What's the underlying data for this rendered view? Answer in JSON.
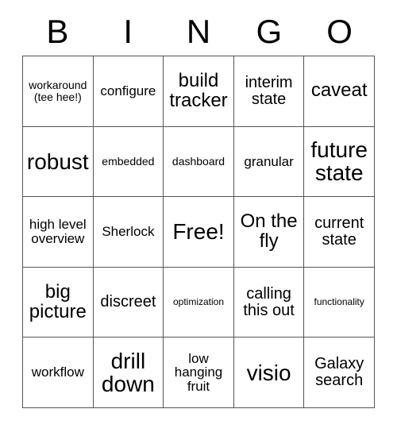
{
  "card": {
    "header_letters": [
      "B",
      "I",
      "N",
      "G",
      "O"
    ],
    "rows": [
      [
        {
          "text": "workaround (tee hee!)",
          "size": "fs-s"
        },
        {
          "text": "configure",
          "size": "fs-m"
        },
        {
          "text": "build tracker",
          "size": "fs-xl"
        },
        {
          "text": "interim state",
          "size": "fs-l"
        },
        {
          "text": "caveat",
          "size": "fs-xl"
        }
      ],
      [
        {
          "text": "robust",
          "size": "fs-xxl"
        },
        {
          "text": "embedded",
          "size": "fs-s"
        },
        {
          "text": "dashboard",
          "size": "fs-s"
        },
        {
          "text": "granular",
          "size": "fs-m"
        },
        {
          "text": "future state",
          "size": "fs-xxl"
        }
      ],
      [
        {
          "text": "high level overview",
          "size": "fs-m"
        },
        {
          "text": "Sherlock",
          "size": "fs-m"
        },
        {
          "text": "Free!",
          "size": "fs-xxl"
        },
        {
          "text": "On the fly",
          "size": "fs-xl"
        },
        {
          "text": "current state",
          "size": "fs-l"
        }
      ],
      [
        {
          "text": "big picture",
          "size": "fs-xl"
        },
        {
          "text": "discreet",
          "size": "fs-l"
        },
        {
          "text": "optimization",
          "size": "fs-xs"
        },
        {
          "text": "calling this out",
          "size": "fs-l"
        },
        {
          "text": "functionality",
          "size": "fs-xs"
        }
      ],
      [
        {
          "text": "workflow",
          "size": "fs-m"
        },
        {
          "text": "drill down",
          "size": "fs-xxl"
        },
        {
          "text": "low hanging fruit",
          "size": "fs-m"
        },
        {
          "text": "visio",
          "size": "fs-xxl"
        },
        {
          "text": "Galaxy search",
          "size": "fs-l"
        }
      ]
    ]
  },
  "colors": {
    "background": "#ffffff",
    "text": "#000000",
    "border": "#555555"
  }
}
